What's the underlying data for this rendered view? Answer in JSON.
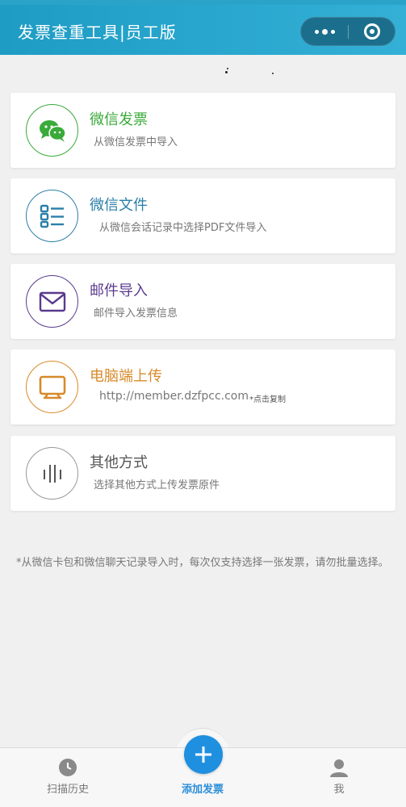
{
  "header": {
    "title": "发票查重工具|员工版",
    "more_icon": "more-dots-icon",
    "close_icon": "miniprogram-close-icon"
  },
  "options": [
    {
      "title": "微信发票",
      "subtitle": "从微信发票中导入",
      "icon": "wechat-icon",
      "color": "#3aaa3a"
    },
    {
      "title": "微信文件",
      "subtitle": "从微信会话记录中选择PDF文件导入",
      "icon": "file-list-icon",
      "color": "#2b7fa8"
    },
    {
      "title": "邮件导入",
      "subtitle": "邮件导入发票信息",
      "icon": "mail-icon",
      "color": "#5a3a8e"
    },
    {
      "title": "电脑端上传",
      "subtitle": "http://member.dzfpcc.com",
      "copy_hint": "*点击复制",
      "icon": "monitor-icon",
      "color": "#d88a2a"
    },
    {
      "title": "其他方式",
      "subtitle": "选择其他方式上传发票原件",
      "icon": "barcode-lines-icon",
      "color": "#555555"
    }
  ],
  "note": "*从微信卡包和微信聊天记录导入时，每次仅支持选择一张发票，请勿批量选择。",
  "tabbar": {
    "history_label": "扫描历史",
    "add_label": "添加发票",
    "me_label": "我",
    "active_color": "#2b8ed9"
  }
}
